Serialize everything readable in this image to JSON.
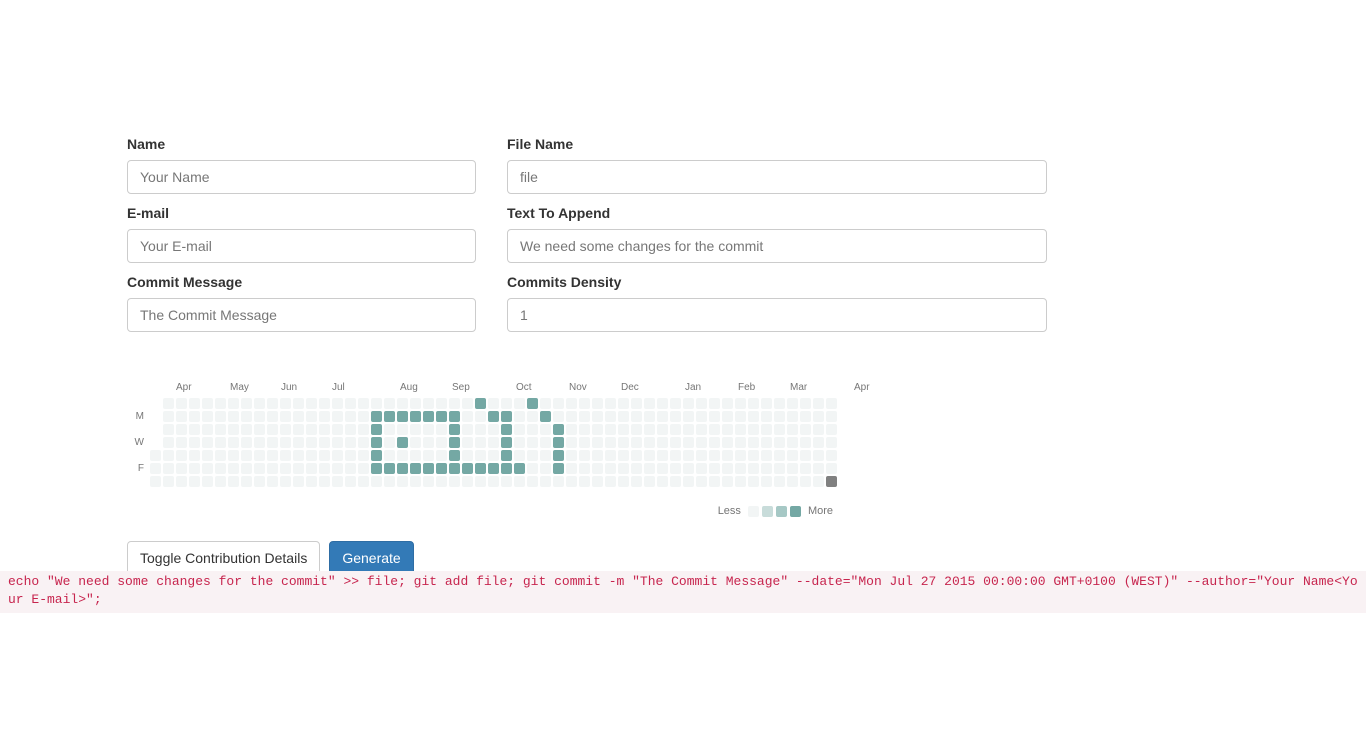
{
  "form": {
    "fields": [
      {
        "label": "Name",
        "placeholder": "Your Name",
        "value": ""
      },
      {
        "label": "File Name",
        "placeholder": "file",
        "value": ""
      },
      {
        "label": "E-mail",
        "placeholder": "Your E-mail",
        "value": ""
      },
      {
        "label": "Text To Append",
        "placeholder": "We need some changes for the commit",
        "value": ""
      },
      {
        "label": "Commit Message",
        "placeholder": "The Commit Message",
        "value": ""
      },
      {
        "label": "Commits Density",
        "placeholder": "1",
        "value": ""
      }
    ]
  },
  "calendar": {
    "months": [
      "Apr",
      "May",
      "Jun",
      "Jul",
      "Aug",
      "Sep",
      "Oct",
      "Nov",
      "Dec",
      "Jan",
      "Feb",
      "Mar",
      "Apr"
    ],
    "month_positions": [
      26,
      80,
      131,
      182,
      250,
      302,
      366,
      419,
      471,
      535,
      588,
      640,
      704
    ],
    "day_labels": [
      {
        "text": "M",
        "row": 1
      },
      {
        "text": "W",
        "row": 3
      },
      {
        "text": "F",
        "row": 5
      }
    ],
    "weeks": 53,
    "days_per_week": 7,
    "leading_blank_days": 4,
    "today_cell": {
      "week": 52,
      "day": 6
    },
    "filled_cells": [
      [
        17,
        1
      ],
      [
        17,
        2
      ],
      [
        17,
        3
      ],
      [
        17,
        4
      ],
      [
        17,
        5
      ],
      [
        18,
        1
      ],
      [
        18,
        5
      ],
      [
        19,
        1
      ],
      [
        19,
        3
      ],
      [
        19,
        5
      ],
      [
        20,
        1
      ],
      [
        20,
        5
      ],
      [
        21,
        1
      ],
      [
        21,
        5
      ],
      [
        22,
        1
      ],
      [
        22,
        5
      ],
      [
        23,
        1
      ],
      [
        23,
        2
      ],
      [
        23,
        3
      ],
      [
        23,
        4
      ],
      [
        23,
        5
      ],
      [
        24,
        5
      ],
      [
        25,
        0
      ],
      [
        25,
        5
      ],
      [
        26,
        1
      ],
      [
        26,
        5
      ],
      [
        27,
        1
      ],
      [
        27,
        2
      ],
      [
        27,
        3
      ],
      [
        27,
        4
      ],
      [
        27,
        5
      ],
      [
        28,
        5
      ],
      [
        29,
        0
      ],
      [
        30,
        1
      ],
      [
        31,
        2
      ],
      [
        31,
        3
      ],
      [
        31,
        4
      ],
      [
        31,
        5
      ]
    ],
    "legend": {
      "less_label": "Less",
      "more_label": "More",
      "swatches": [
        "#f2f5f5",
        "#c8dcda",
        "#a6c8c5",
        "#74a8a4"
      ]
    }
  },
  "buttons": {
    "toggle_label": "Toggle Contribution Details",
    "generate_label": "Generate"
  },
  "command": {
    "text": "echo \"We need some changes for the commit\" >> file; git add file; git commit -m \"The Commit Message\" --date=\"Mon Jul 27 2015 00:00:00 GMT+0100 (WEST)\" --author=\"Your Name<Your E-mail>\";"
  },
  "colors": {
    "accent": "#74a8a4",
    "primary_button": "#337ab7",
    "command_text": "#c7254e",
    "command_bg": "#f9f2f4"
  }
}
